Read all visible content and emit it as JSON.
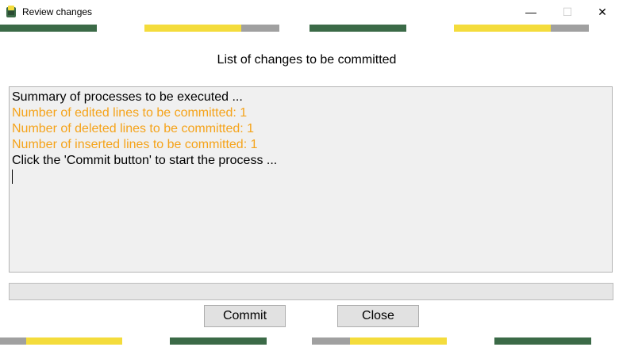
{
  "window": {
    "title": "Review changes",
    "minimize_glyph": "—",
    "maximize_glyph": "☐",
    "close_glyph": "✕"
  },
  "colors": {
    "green": "#3b6a47",
    "yellow": "#f4dc3c",
    "gray": "#a0a0a0",
    "orange": "#f5a31a"
  },
  "heading": "List of changes to be committed",
  "log": {
    "lines": [
      {
        "text": "Summary of processes to be executed ...",
        "color": "#000000"
      },
      {
        "text": "Number of edited lines to be committed: 1",
        "color": "#f5a31a"
      },
      {
        "text": "Number of deleted lines to be committed: 1",
        "color": "#f5a31a"
      },
      {
        "text": "Number of inserted lines to be committed: 1",
        "color": "#f5a31a"
      },
      {
        "text": "Click the 'Commit button' to start the process ...",
        "color": "#000000"
      }
    ]
  },
  "progress": {
    "value": 0
  },
  "buttons": {
    "commit": "Commit",
    "close": "Close"
  }
}
